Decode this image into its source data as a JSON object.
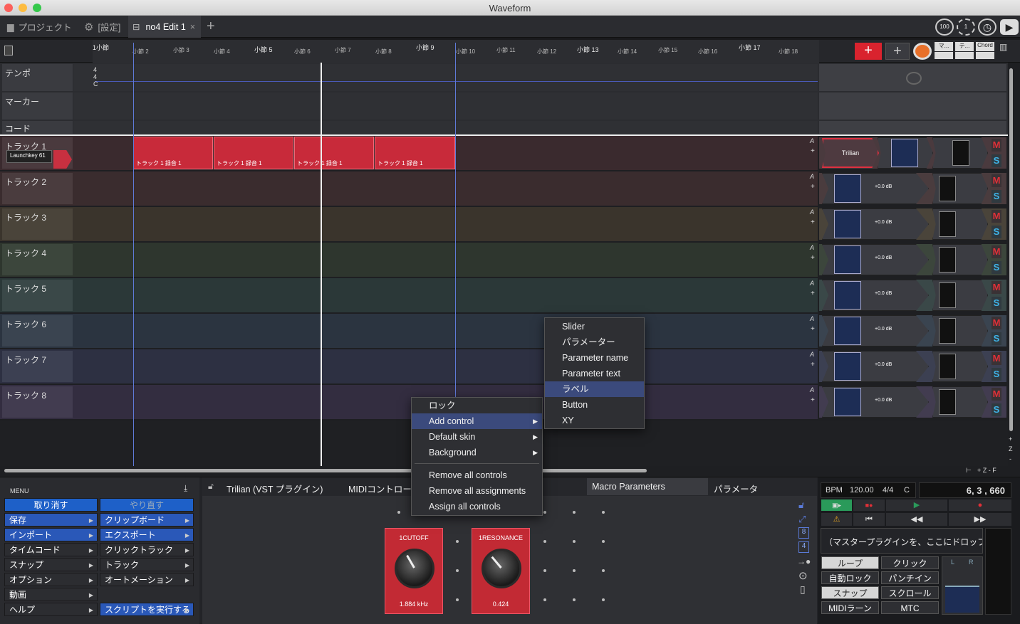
{
  "window": {
    "title": "Waveform"
  },
  "tabs": [
    {
      "label": "プロジェクト"
    },
    {
      "label": "[設定]"
    },
    {
      "label": "no4 Edit 1"
    }
  ],
  "toolbar_right": {
    "counter_a": "100",
    "counter_b": "1"
  },
  "ruler": {
    "bars_big": [
      "1小節",
      "小節 5",
      "小節 9",
      "小節 13",
      "小節 17"
    ],
    "bars_small": [
      "小節 2",
      "小節 3",
      "小節 4",
      "小節 6",
      "小節 7",
      "小節 8",
      "小節 10",
      "小節 11",
      "小節 12",
      "小節 14",
      "小節 15",
      "小節 16",
      "小節 18"
    ]
  },
  "top_right_buttons": {
    "m": "マ...",
    "t": "テ...",
    "chord": "Chord"
  },
  "global_rows": {
    "tempo": "テンポ",
    "marker": "マーカー",
    "chord": "コード",
    "time_sig": [
      "4",
      "4",
      "C"
    ]
  },
  "tracks": [
    {
      "name": "トラック 1",
      "device": "Launchkey 61",
      "plugin": "Trilian"
    },
    {
      "name": "トラック 2",
      "gain": "+0.0 dB"
    },
    {
      "name": "トラック 3",
      "gain": "+0.0 dB"
    },
    {
      "name": "トラック 4",
      "gain": "+0.0 dB"
    },
    {
      "name": "トラック 5",
      "gain": "+0.0 dB"
    },
    {
      "name": "トラック 6",
      "gain": "+0.0 dB"
    },
    {
      "name": "トラック 7",
      "gain": "+0.0 dB"
    },
    {
      "name": "トラック 8",
      "gain": "+0.0 dB"
    }
  ],
  "clips": [
    "トラック 1 録音 1",
    "トラック 1 録音 1",
    "トラック 1 録音 1",
    "トラック 1 録音 1"
  ],
  "panel_labels": {
    "a": "A",
    "plus": "+",
    "m": "M",
    "s": "S"
  },
  "context_menu": [
    {
      "label": "ロック"
    },
    {
      "label": "Add control",
      "submenu": true
    },
    {
      "label": "Default skin",
      "submenu": true
    },
    {
      "label": "Background",
      "submenu": true
    },
    {
      "label": "Remove all controls"
    },
    {
      "label": "Remove all assignments"
    },
    {
      "label": "Assign all controls"
    }
  ],
  "submenu": [
    "Slider",
    "パラメーター",
    "Parameter name",
    "Parameter text",
    "ラベル",
    "Button",
    "XY"
  ],
  "zoom_controls": {
    "top": "+",
    "z": "Z",
    "bottom": "-",
    "row": "+ Z - F"
  },
  "menu_panel": {
    "title": "MENU",
    "undo": "取り消す",
    "redo": "やり直す",
    "left": [
      "保存",
      "インポート",
      "タイムコード",
      "スナップ",
      "オプション",
      "動画",
      "ヘルプ"
    ],
    "right": [
      "クリップボード",
      "エクスポート",
      "クリックトラック",
      "トラック",
      "オートメーション",
      "スクリプトを実行する"
    ]
  },
  "plugin_panel": {
    "tabs": [
      "Trilian (VST プラグイン)",
      "MIDIコントロー",
      "Macro Parameters",
      "パラメータ"
    ],
    "side_numbers": [
      "8",
      "4"
    ],
    "knobs": [
      {
        "label": "1CUTOFF",
        "value": "1.884 kHz"
      },
      {
        "label": "1RESONANCE",
        "value": "0.424"
      }
    ]
  },
  "transport": {
    "bpm_label": "BPM",
    "bpm": "120.00",
    "time_sig": "4/4",
    "key": "C",
    "position": "6, 3 , 660",
    "master_drop": "（マスタープラグインを、ここにドロップ）",
    "buttons": [
      "ループ",
      "クリック",
      "自動ロック",
      "パンチイン",
      "スナップ",
      "スクロール",
      "MIDIラーン",
      "MTC"
    ],
    "lr": [
      "L",
      "R"
    ]
  }
}
